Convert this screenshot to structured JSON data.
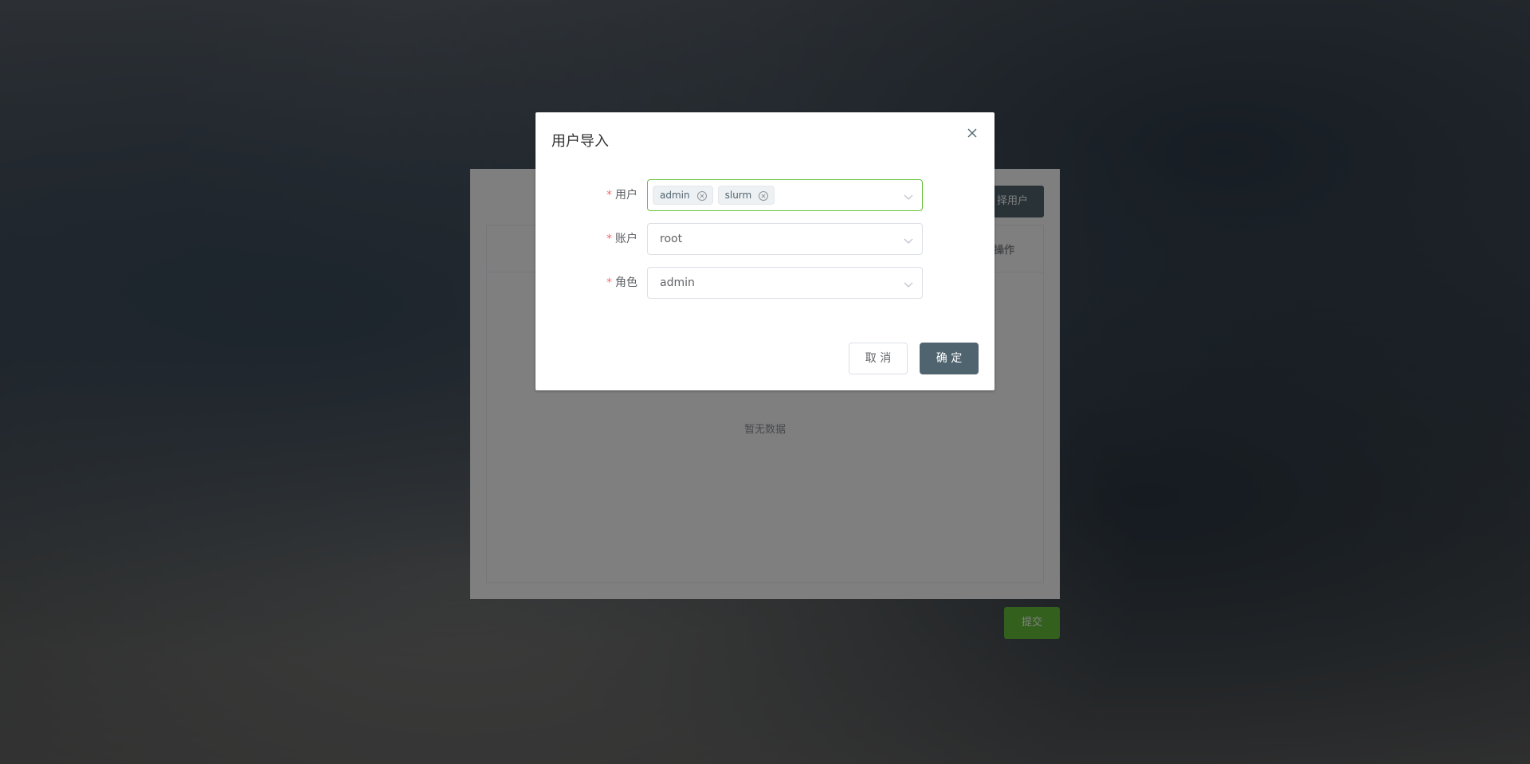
{
  "background": {
    "select_user_button": "择用户",
    "table_header_operation": "操作",
    "empty_text": "暂无数据",
    "submit_button": "提交"
  },
  "dialog": {
    "title": "用户导入",
    "fields": {
      "user": {
        "label": "用户",
        "tags": [
          "admin",
          "slurm"
        ]
      },
      "account": {
        "label": "账户",
        "value": "root"
      },
      "role": {
        "label": "角色",
        "value": "admin"
      }
    },
    "required_mark": "*",
    "cancel_label": "取 消",
    "confirm_label": "确 定"
  },
  "colors": {
    "primary": "#50646f",
    "success": "#67c23a",
    "danger": "#f56c6c"
  }
}
